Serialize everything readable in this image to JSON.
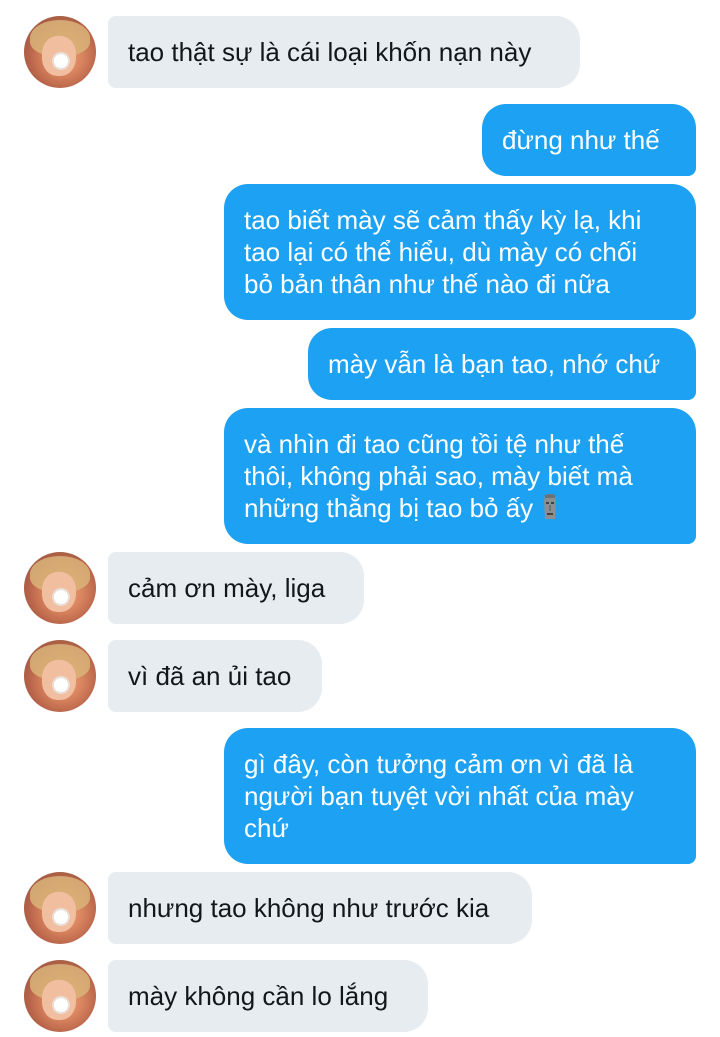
{
  "messages": [
    {
      "side": "in",
      "text": "tao thật sự là cái loại khốn nạn này"
    },
    {
      "side": "out",
      "text": "đừng như thế"
    },
    {
      "side": "out",
      "lines": [
        "tao biết mày sẽ cảm thấy kỳ lạ, khi",
        "tao lại có thể hiểu, dù mày có chối",
        "bỏ bản thân như thế nào đi nữa"
      ]
    },
    {
      "side": "out",
      "text": "mày vẫn là bạn tao, nhớ chứ"
    },
    {
      "side": "out",
      "lines": [
        "và nhìn đi tao cũng tồi tệ như thế",
        "thôi, không phải sao, mày biết mà",
        "những thằng bị tao bỏ ấy"
      ],
      "emoji": "moai-emoji"
    },
    {
      "side": "in",
      "text": "cảm ơn mày, liga"
    },
    {
      "side": "in",
      "text": "vì đã an ủi tao"
    },
    {
      "side": "out",
      "lines": [
        "gì đây, còn tưởng cảm ơn vì đã là",
        "người bạn tuyệt vời nhất của mày",
        "chứ"
      ]
    },
    {
      "side": "in",
      "text": "nhưng tao không như trước kia"
    },
    {
      "side": "in",
      "text": "mày không cần lo lắng"
    }
  ],
  "colors": {
    "incoming_bubble": "#e6ecf0",
    "outgoing_bubble": "#1da1f2",
    "incoming_text": "#14171a",
    "outgoing_text": "#ffffff"
  }
}
